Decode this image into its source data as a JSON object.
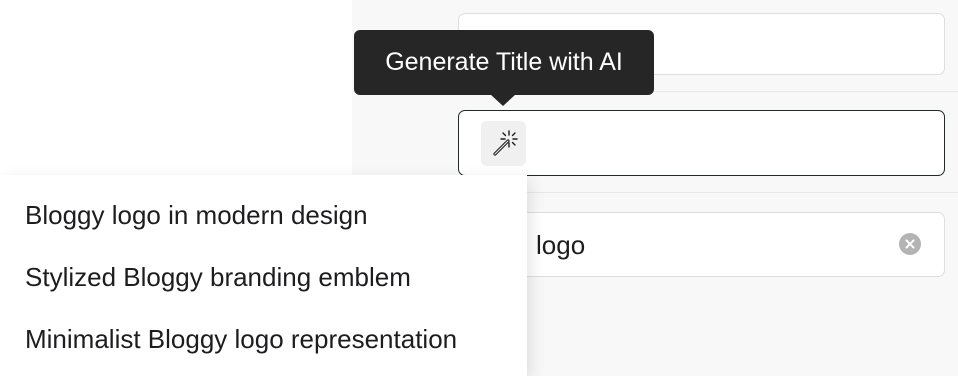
{
  "tooltip": {
    "text": "Generate Title with AI"
  },
  "fields": {
    "title_field_value": "",
    "alt_field_value": "logo"
  },
  "icons": {
    "ai_button": "magic-wand-icon",
    "clear_button": "clear-circle-icon"
  },
  "suggestions": [
    "Bloggy logo in modern design",
    "Stylized Bloggy branding emblem",
    "Minimalist Bloggy logo representation"
  ],
  "colors": {
    "tooltip_background": "#262626",
    "focused_border": "#1e2a26",
    "default_border": "#dedede",
    "clear_icon": "#b4b4b4"
  }
}
